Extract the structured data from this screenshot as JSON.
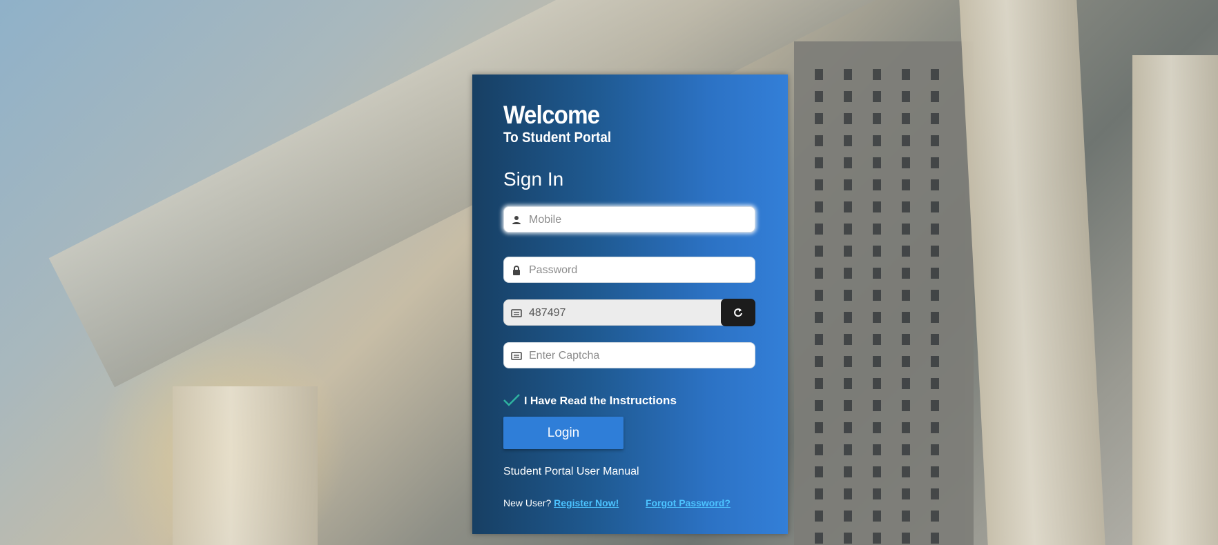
{
  "header": {
    "welcome": "Welcome",
    "subtitle": "To Student Portal"
  },
  "form": {
    "title": "Sign In",
    "mobile": {
      "placeholder": "Mobile",
      "value": "",
      "icon": "user-icon"
    },
    "password": {
      "placeholder": "Password",
      "value": "",
      "icon": "lock-icon"
    },
    "captcha_display": {
      "value": "487497",
      "icon": "keyboard-icon"
    },
    "captcha_input": {
      "placeholder": "Enter Captcha",
      "value": "",
      "icon": "keyboard-icon"
    },
    "refresh_icon": "refresh-icon",
    "instructions": {
      "prefix": "I Have Read the ",
      "emphasis": "Instructions",
      "checked": true
    },
    "login_label": "Login"
  },
  "links": {
    "manual": "Student Portal User Manual",
    "new_user": "New User?",
    "register": "Register Now!",
    "forgot": "Forgot Password?"
  },
  "colors": {
    "panel_start": "#173f63",
    "panel_end": "#337fd8",
    "button": "#2f7ed8",
    "link": "#4cc3ff",
    "check": "#2fb3a0"
  }
}
